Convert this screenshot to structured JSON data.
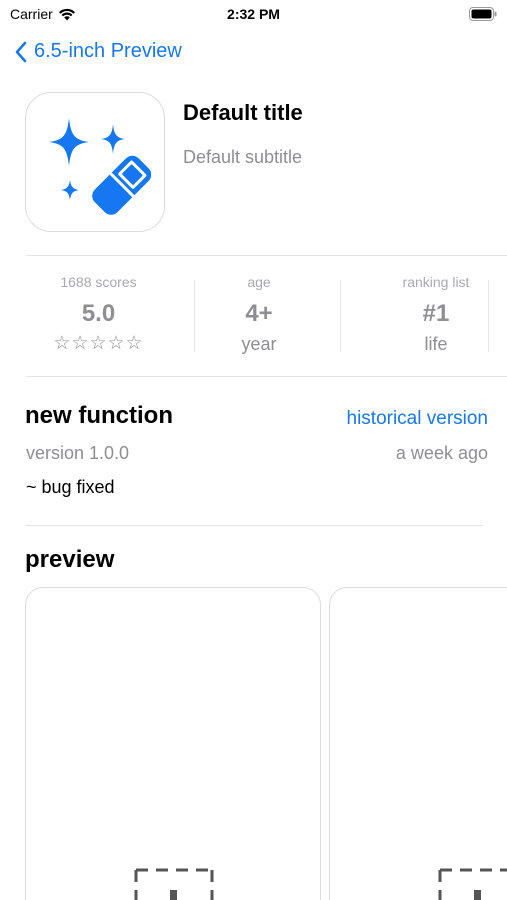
{
  "status_bar": {
    "carrier": "Carrier",
    "time": "2:32 PM",
    "wifi_icon": "wifi-icon",
    "battery_icon": "battery-icon"
  },
  "nav": {
    "back_label": "6.5-inch Preview",
    "back_icon": "chevron-left-icon"
  },
  "app": {
    "title": "Default title",
    "subtitle": "Default subtitle",
    "icon": "sparkle-wand-icon",
    "accent_color": "#1677f2"
  },
  "stats": {
    "scores": {
      "label": "1688 scores",
      "value": "5.0",
      "stars": "☆☆☆☆☆"
    },
    "age": {
      "label": "age",
      "value": "4+",
      "sub": "year"
    },
    "ranking": {
      "label": "ranking list",
      "value": "#1",
      "sub": "life"
    }
  },
  "new_function": {
    "title": "new function",
    "history_link": "historical version",
    "version": "version 1.0.0",
    "date": "a week ago",
    "notes": "~ bug fixed"
  },
  "preview": {
    "title": "preview",
    "placeholder_icon": "image-placeholder-icon"
  },
  "colors": {
    "link": "#1878e8",
    "secondary_text": "#8e8e93",
    "divider": "#e3e3e6"
  }
}
